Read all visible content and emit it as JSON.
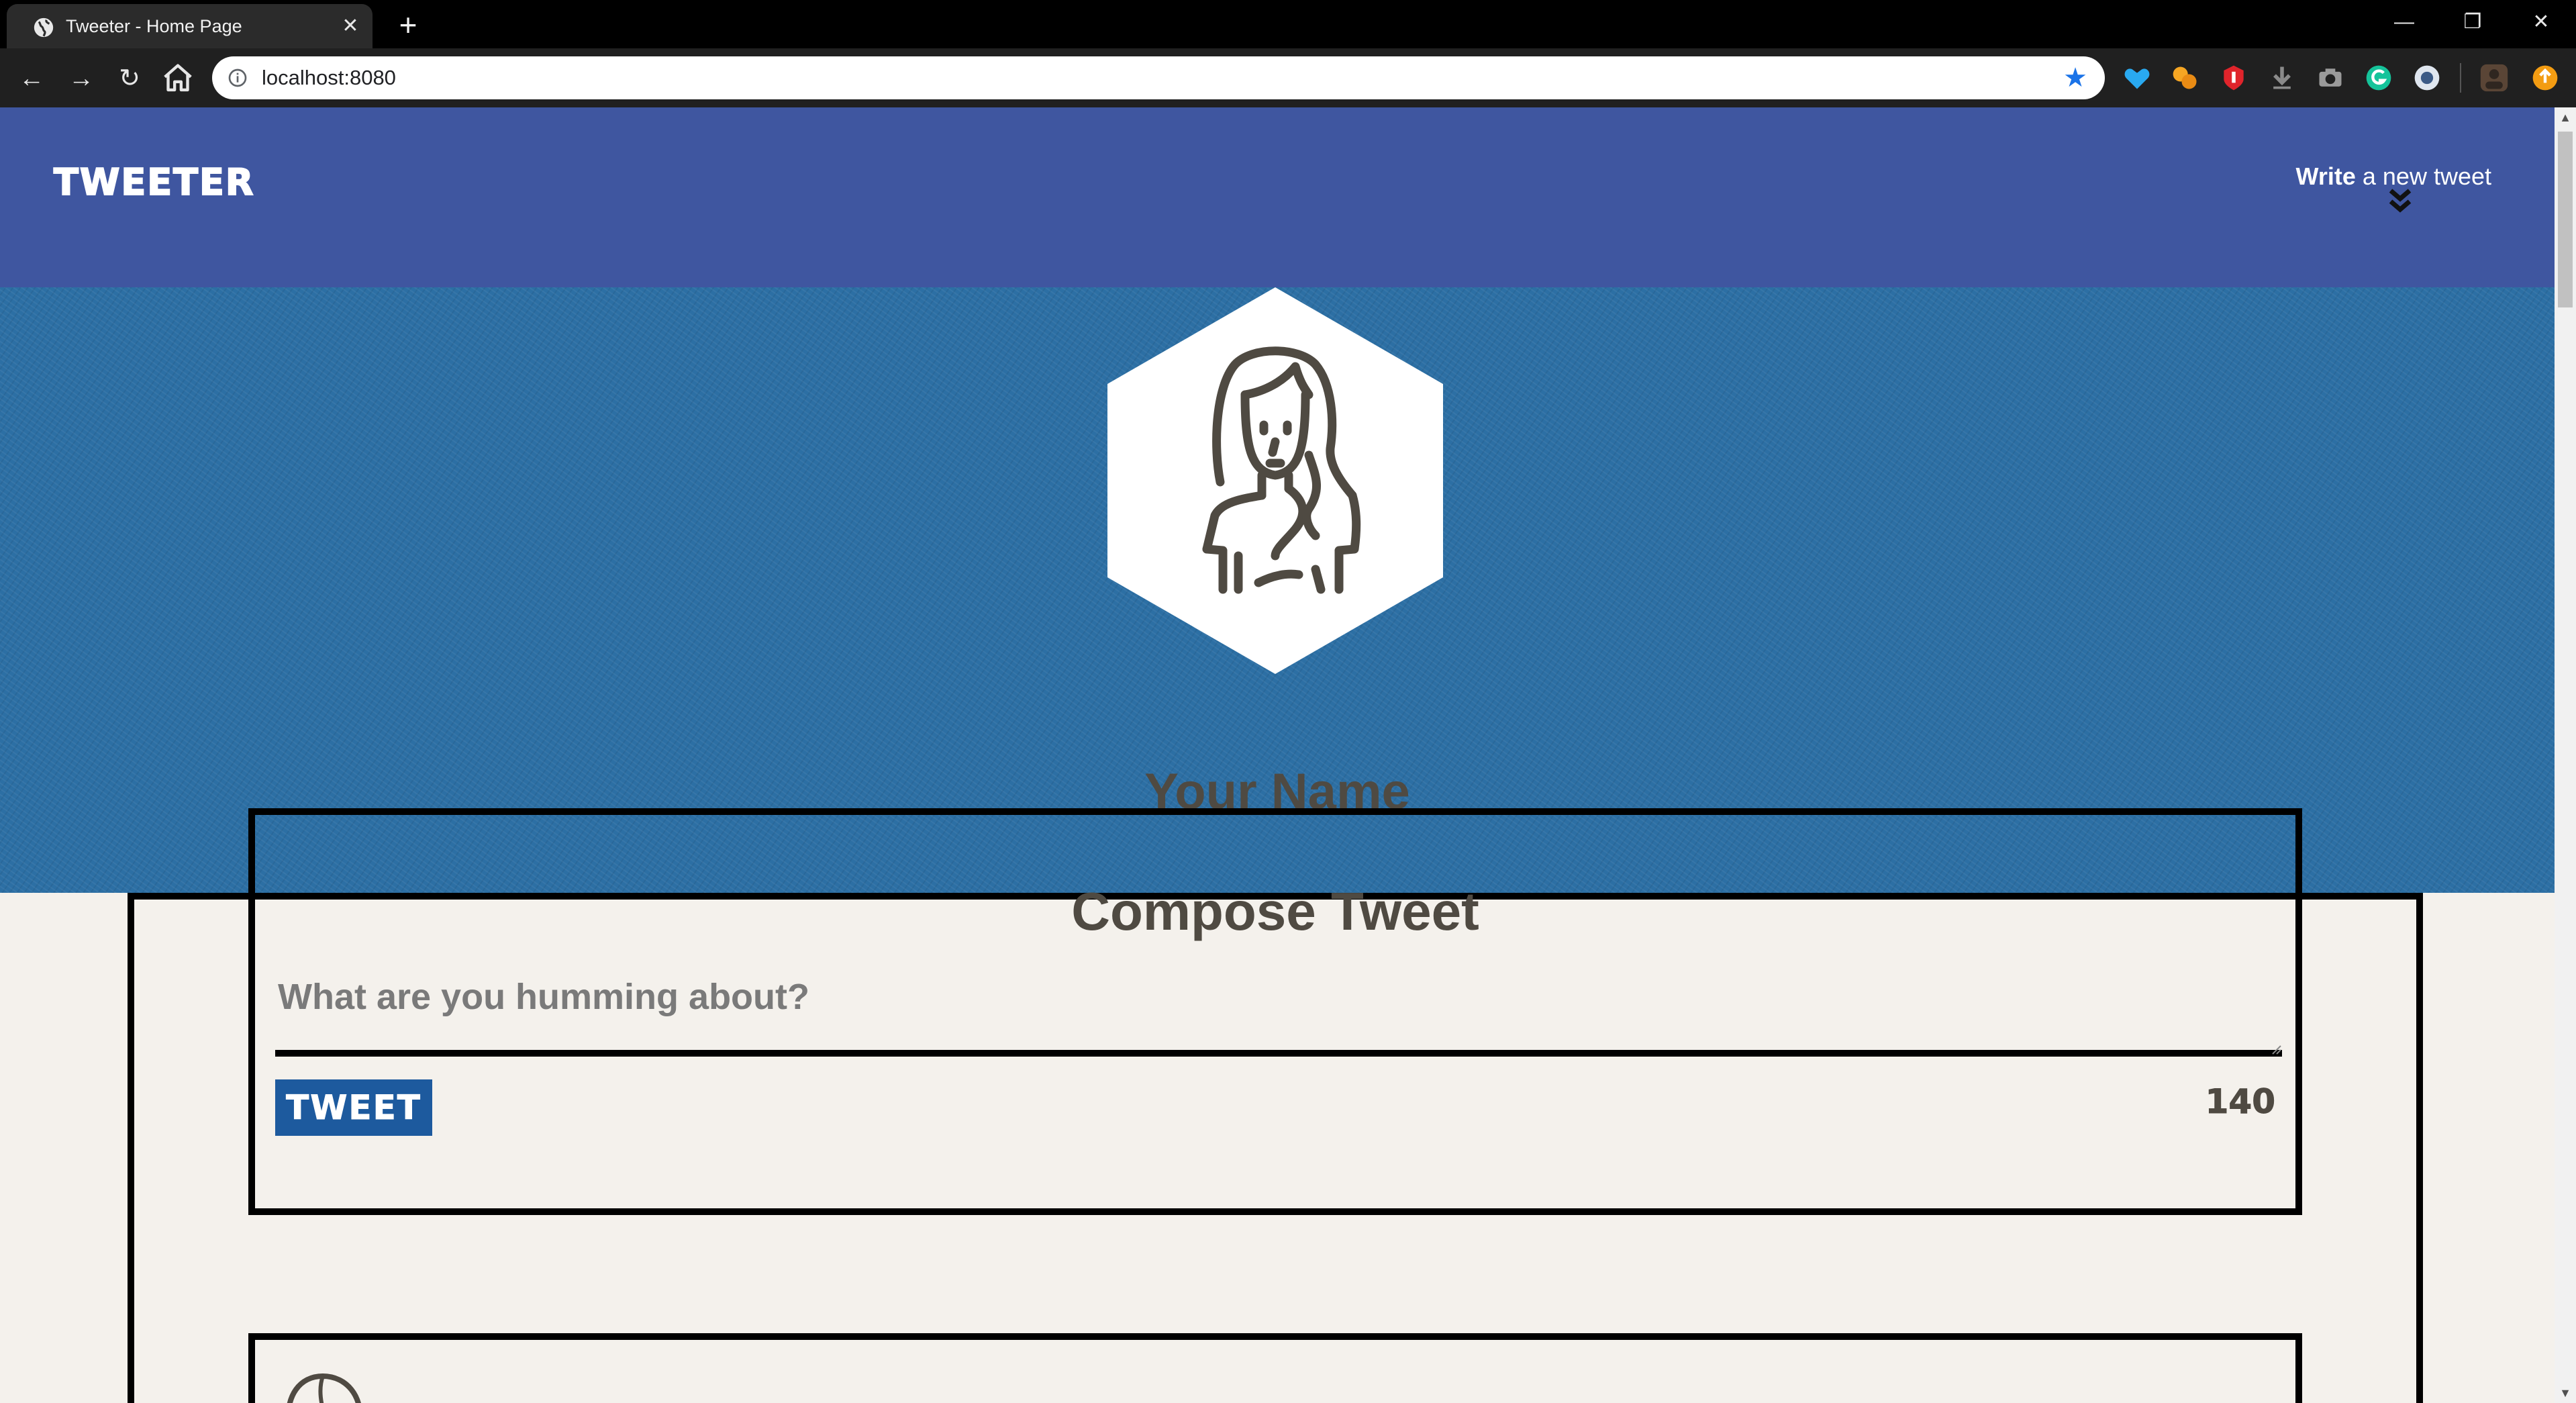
{
  "browser": {
    "tab_title": "Tweeter - Home Page",
    "url": "localhost:8080",
    "icons": {
      "favicon": "globe-icon",
      "close": "close-icon",
      "new_tab": "plus-icon",
      "back": "arrow-left-icon",
      "forward": "arrow-right-icon",
      "reload": "reload-icon",
      "home": "home-icon",
      "info": "info-icon",
      "bookmark": "star-icon",
      "minimize": "minimize-icon",
      "restore": "restore-icon",
      "window_close": "close-icon"
    },
    "extensions": [
      "heart-extension-icon",
      "puzzle-extension-icon",
      "shield-extension-icon",
      "download-extension-icon",
      "camera-extension-icon",
      "grammarly-extension-icon",
      "circle-extension-icon",
      "profile-avatar-icon",
      "update-icon"
    ],
    "colors": {
      "tabbar": "#000000",
      "toolbar": "#202020",
      "star": "#1a73e8"
    }
  },
  "nav": {
    "brand": "TWEETER",
    "write_bold": "Write",
    "write_rest": " a new tweet",
    "chevron_icon": "double-chevron-down-icon"
  },
  "profile": {
    "name": "Your Name",
    "avatar_icon": "user-avatar-icon"
  },
  "compose": {
    "title": "Compose Tweet",
    "placeholder": "What are you humming about?",
    "button_label": "TWEET",
    "counter": "140"
  },
  "colors": {
    "nav_bg": "#3f56a0",
    "hero_bg": "#2c6fa4",
    "page_bg": "#f4f1ec",
    "button_bg": "#1d5a9e",
    "text_dark": "#4f4a42"
  }
}
